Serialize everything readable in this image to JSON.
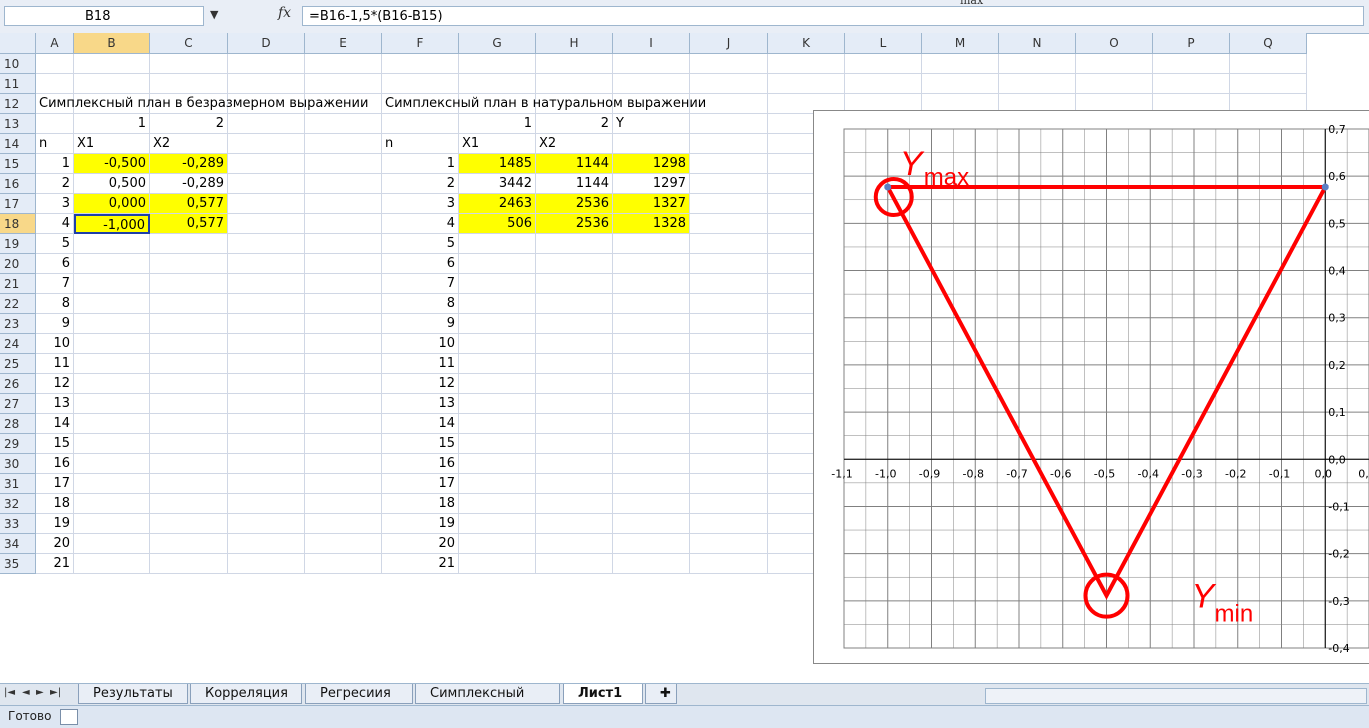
{
  "formula_bar": {
    "cell_ref": "B18",
    "formula": "=B16-1,5*(B16-B15)",
    "fx_label": "fx"
  },
  "top_note": "max",
  "columns": [
    "A",
    "B",
    "C",
    "D",
    "E",
    "F",
    "G",
    "H",
    "I",
    "J",
    "K",
    "L",
    "M",
    "N",
    "O",
    "P",
    "Q"
  ],
  "rows": [
    "10",
    "11",
    "12",
    "13",
    "14",
    "15",
    "16",
    "17",
    "18",
    "19",
    "20",
    "21",
    "22",
    "23",
    "24",
    "25",
    "26",
    "27",
    "28",
    "29",
    "30",
    "31",
    "32",
    "33",
    "34",
    "35"
  ],
  "selected": {
    "column": "B",
    "row": "18"
  },
  "sheet": {
    "title_left": "Симплексный план в безразмерном выражении",
    "title_right": "Симплексный план в натуральном выражении",
    "left_table": {
      "factor_numbers": [
        "1",
        "2"
      ],
      "headers": [
        "n",
        "X1",
        "X2"
      ],
      "rows": [
        [
          "1",
          "-0,500",
          "-0,289"
        ],
        [
          "2",
          "0,500",
          "-0,289"
        ],
        [
          "3",
          "0,000",
          "0,577"
        ],
        [
          "4",
          "-1,000",
          "0,577"
        ],
        [
          "5",
          "",
          ""
        ],
        [
          "6",
          "",
          ""
        ],
        [
          "7",
          "",
          ""
        ],
        [
          "8",
          "",
          ""
        ],
        [
          "9",
          "",
          ""
        ],
        [
          "10",
          "",
          ""
        ],
        [
          "11",
          "",
          ""
        ],
        [
          "12",
          "",
          ""
        ],
        [
          "13",
          "",
          ""
        ],
        [
          "14",
          "",
          ""
        ],
        [
          "15",
          "",
          ""
        ],
        [
          "16",
          "",
          ""
        ],
        [
          "17",
          "",
          ""
        ],
        [
          "18",
          "",
          ""
        ],
        [
          "19",
          "",
          ""
        ],
        [
          "20",
          "",
          ""
        ],
        [
          "21",
          "",
          ""
        ]
      ]
    },
    "right_table": {
      "factor_numbers": [
        "1",
        "2"
      ],
      "headers": [
        "n",
        "X1",
        "X2",
        "Y"
      ],
      "rows": [
        [
          "1",
          "1485",
          "1144",
          "1298"
        ],
        [
          "2",
          "3442",
          "1144",
          "1297"
        ],
        [
          "3",
          "2463",
          "2536",
          "1327"
        ],
        [
          "4",
          "506",
          "2536",
          "1328"
        ],
        [
          "5",
          "",
          "",
          ""
        ],
        [
          "6",
          "",
          "",
          ""
        ],
        [
          "7",
          "",
          "",
          ""
        ],
        [
          "8",
          "",
          "",
          ""
        ],
        [
          "9",
          "",
          "",
          ""
        ],
        [
          "10",
          "",
          "",
          ""
        ],
        [
          "11",
          "",
          "",
          ""
        ],
        [
          "12",
          "",
          "",
          ""
        ],
        [
          "13",
          "",
          "",
          ""
        ],
        [
          "14",
          "",
          "",
          ""
        ],
        [
          "15",
          "",
          "",
          ""
        ],
        [
          "16",
          "",
          "",
          ""
        ],
        [
          "17",
          "",
          "",
          ""
        ],
        [
          "18",
          "",
          "",
          ""
        ],
        [
          "19",
          "",
          "",
          ""
        ],
        [
          "20",
          "",
          "",
          ""
        ],
        [
          "21",
          "",
          "",
          ""
        ]
      ]
    }
  },
  "chart_data": {
    "type": "scatter",
    "xlim": [
      -1.1,
      0.1
    ],
    "ylim": [
      -0.4,
      0.7
    ],
    "x_ticks": [
      "-1,1",
      "-1,0",
      "-0,9",
      "-0,8",
      "-0,7",
      "-0,6",
      "-0,5",
      "-0,4",
      "-0,3",
      "-0,2",
      "-0,1",
      "0,0",
      "0,1"
    ],
    "y_ticks": [
      "0,7",
      "0,6",
      "0,5",
      "0,4",
      "0,3",
      "0,2",
      "0,1",
      "0,0",
      "-0,1",
      "-0,2",
      "-0,3",
      "-0,4"
    ],
    "grid": true,
    "points": [
      {
        "x": -1.0,
        "y": 0.577
      },
      {
        "x": 0.0,
        "y": 0.577
      }
    ],
    "triangle": [
      {
        "x": -1.0,
        "y": 0.577
      },
      {
        "x": 0.0,
        "y": 0.577
      },
      {
        "x": -0.5,
        "y": -0.289
      }
    ],
    "annotations": [
      {
        "label": "Y",
        "sub": "max",
        "x": -1.0,
        "y": 0.577
      },
      {
        "label": "Y",
        "sub": "min",
        "x": -0.5,
        "y": -0.289
      }
    ],
    "colors": {
      "triangle": "#ff0000",
      "marker": "#5b7fc4",
      "grid": "#808080"
    }
  },
  "tabs": {
    "nav": [
      "|◄",
      "◄",
      "►",
      "►|"
    ],
    "items": [
      "Результаты",
      "Корреляция",
      "Регресиия",
      "Симплексный план",
      "Лист1"
    ],
    "active_index": 4
  },
  "status": {
    "text": "Готово"
  }
}
